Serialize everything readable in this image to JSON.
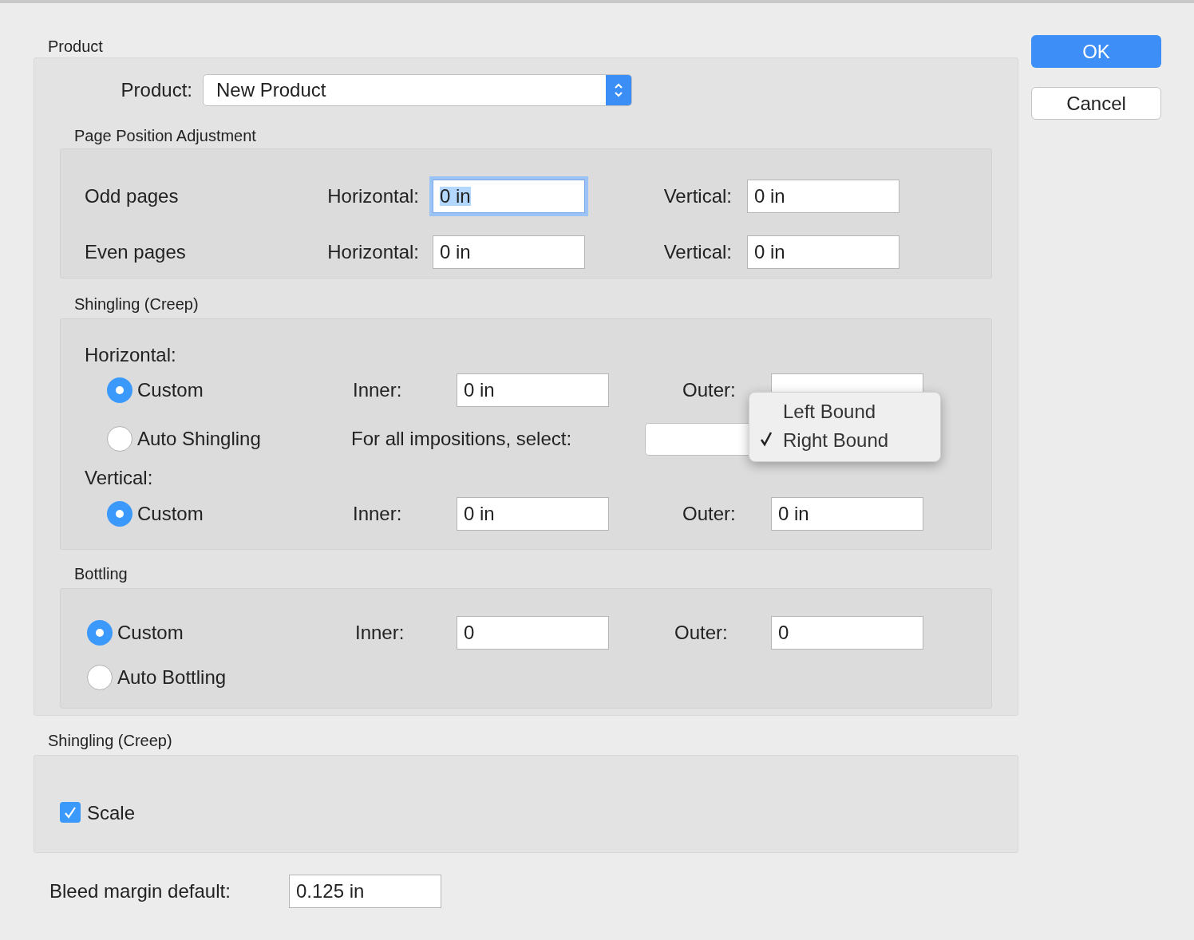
{
  "product_group": {
    "title": "Product",
    "product_label": "Product:",
    "product_value": "New Product",
    "page_position": {
      "title": "Page Position Adjustment",
      "rows": [
        {
          "label": "Odd pages",
          "horizontal_label": "Horizontal:",
          "horizontal": {
            "value": "0 in",
            "focused": true
          },
          "vertical_label": "Vertical:",
          "vertical": {
            "value": "0 in",
            "focused": false
          }
        },
        {
          "label": "Even pages",
          "horizontal_label": "Horizontal:",
          "horizontal": {
            "value": "0 in",
            "focused": false
          },
          "vertical_label": "Vertical:",
          "vertical": {
            "value": "0 in",
            "focused": false
          }
        }
      ]
    },
    "shingling": {
      "title": "Shingling (Creep)",
      "horizontal_label": "Horizontal:",
      "horizontal_options": [
        {
          "label": "Custom",
          "selected": true
        },
        {
          "label": "Auto Shingling",
          "selected": false
        }
      ],
      "inner_label": "Inner:",
      "inner": "0 in",
      "outer_label": "Outer:",
      "impositions_label": "For all impositions, select:",
      "impositions_menu": [
        {
          "label": "Left Bound",
          "selected": false
        },
        {
          "label": "Right Bound",
          "selected": true
        }
      ],
      "vertical_label": "Vertical:",
      "vertical_options": [
        {
          "label": "Custom",
          "selected": true
        }
      ],
      "v_inner_label": "Inner:",
      "v_inner": "0 in",
      "v_outer_label": "Outer:",
      "v_outer": "0 in"
    },
    "bottling": {
      "title": "Bottling",
      "options": [
        {
          "label": "Custom",
          "selected": true
        },
        {
          "label": "Auto Bottling",
          "selected": false
        }
      ],
      "inner_label": "Inner:",
      "inner": "0",
      "outer_label": "Outer:",
      "outer": "0"
    }
  },
  "scaling_group": {
    "title": "Shingling (Creep)",
    "scale": {
      "label": "Scale",
      "checked": true
    }
  },
  "bleed": {
    "label": "Bleed margin default:",
    "value": "0.125 in"
  },
  "buttons": [
    {
      "label": "OK",
      "kind": "default"
    },
    {
      "label": "Cancel",
      "kind": "normal"
    }
  ]
}
